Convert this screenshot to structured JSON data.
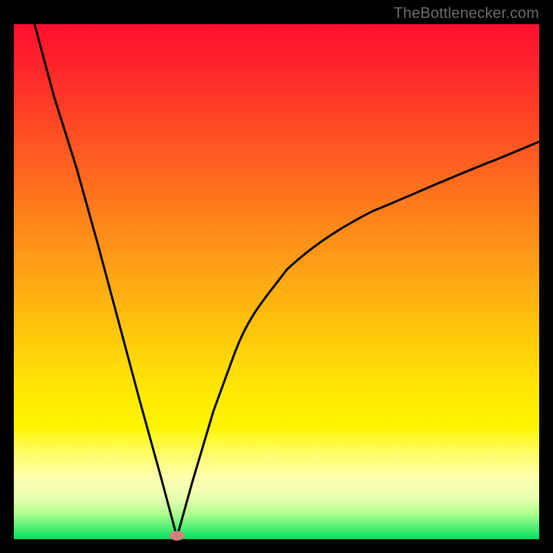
{
  "attribution": "TheBottlenecker.com",
  "chart_data": {
    "type": "line",
    "title": "",
    "xlabel": "",
    "ylabel": "",
    "xlim": [
      0,
      100
    ],
    "ylim": [
      0,
      100
    ],
    "grid": false,
    "legend": false,
    "comment": "Axes are implied (units unlabeled). y descends from top (high bottleneck, red) to bottom (low bottleneck, green). x is an unlabeled horizontal parameter. Curve reaches a minimum (~0) near x≈31.",
    "curve": [
      {
        "x": 4,
        "y": 100
      },
      {
        "x": 8,
        "y": 86
      },
      {
        "x": 12,
        "y": 72
      },
      {
        "x": 16,
        "y": 57
      },
      {
        "x": 20,
        "y": 42
      },
      {
        "x": 24,
        "y": 27
      },
      {
        "x": 28,
        "y": 12
      },
      {
        "x": 31,
        "y": 0
      },
      {
        "x": 34,
        "y": 11
      },
      {
        "x": 38,
        "y": 25
      },
      {
        "x": 42,
        "y": 36
      },
      {
        "x": 48,
        "y": 47
      },
      {
        "x": 55,
        "y": 56
      },
      {
        "x": 63,
        "y": 63
      },
      {
        "x": 72,
        "y": 69
      },
      {
        "x": 82,
        "y": 74
      },
      {
        "x": 92,
        "y": 78
      },
      {
        "x": 100,
        "y": 80
      }
    ],
    "marker": {
      "x": 31,
      "y": 0.5,
      "color": "#d88080"
    },
    "background_gradient": {
      "top": "#ff1030",
      "bottom": "#00e060"
    }
  }
}
